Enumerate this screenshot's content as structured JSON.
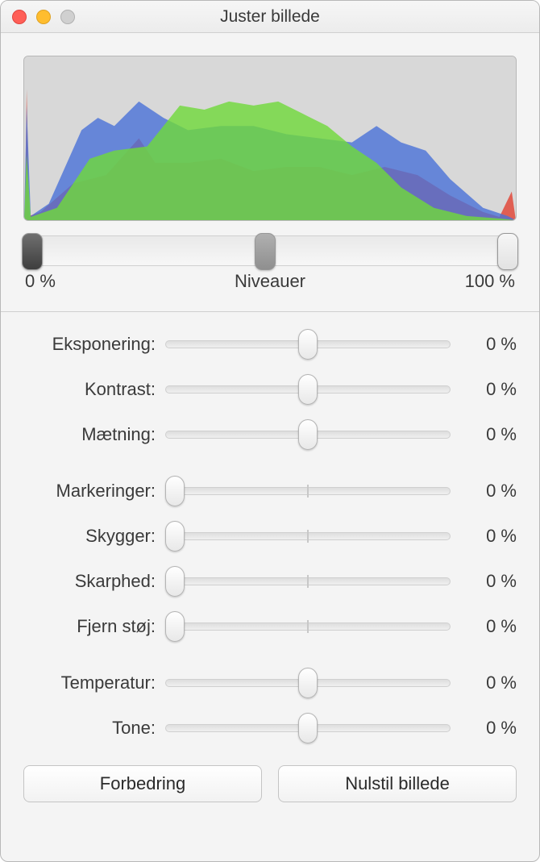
{
  "window": {
    "title": "Juster billede"
  },
  "levels": {
    "min_label": "0 %",
    "center_label": "Niveauer",
    "max_label": "100 %",
    "handles": [
      0,
      49,
      100
    ]
  },
  "slider_groups": [
    [
      {
        "key": "eksponering",
        "label": "Eksponering:",
        "value_label": "0 %",
        "pos": 50,
        "center_mark": false
      },
      {
        "key": "kontrast",
        "label": "Kontrast:",
        "value_label": "0 %",
        "pos": 50,
        "center_mark": false
      },
      {
        "key": "maetning",
        "label": "Mætning:",
        "value_label": "0 %",
        "pos": 50,
        "center_mark": false
      }
    ],
    [
      {
        "key": "markeringer",
        "label": "Markeringer:",
        "value_label": "0 %",
        "pos": 3,
        "center_mark": true
      },
      {
        "key": "skygger",
        "label": "Skygger:",
        "value_label": "0 %",
        "pos": 3,
        "center_mark": true
      },
      {
        "key": "skarphed",
        "label": "Skarphed:",
        "value_label": "0 %",
        "pos": 3,
        "center_mark": true
      },
      {
        "key": "fjern_stoj",
        "label": "Fjern støj:",
        "value_label": "0 %",
        "pos": 3,
        "center_mark": true
      }
    ],
    [
      {
        "key": "temperatur",
        "label": "Temperatur:",
        "value_label": "0 %",
        "pos": 50,
        "center_mark": false
      },
      {
        "key": "tone",
        "label": "Tone:",
        "value_label": "0 %",
        "pos": 50,
        "center_mark": false
      }
    ]
  ],
  "buttons": {
    "enhance_label": "Forbedring",
    "reset_label": "Nulstil billede"
  },
  "traffic_lights": {
    "close": "close",
    "minimize": "minimize",
    "maximize": "maximize"
  }
}
